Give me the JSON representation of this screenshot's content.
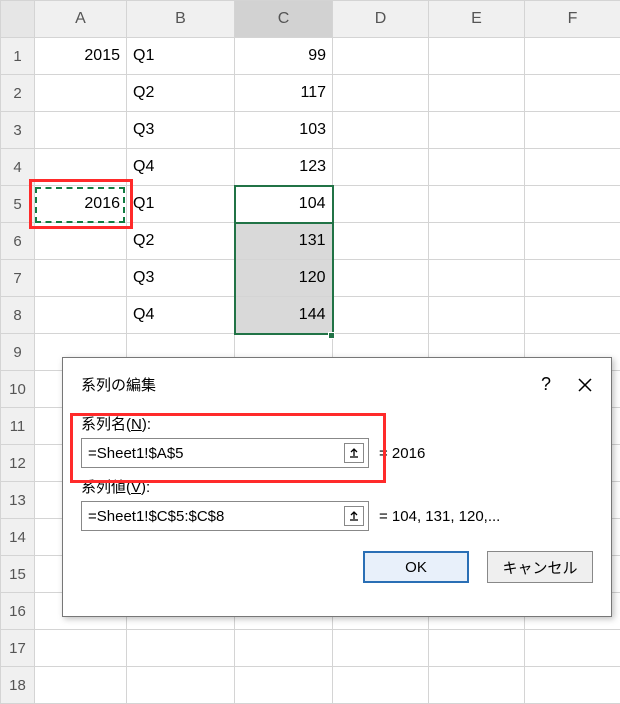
{
  "columns": [
    "A",
    "B",
    "C",
    "D",
    "E",
    "F"
  ],
  "rowcount": 18,
  "cells": {
    "A1": "2015",
    "B1": "Q1",
    "C1": "99",
    "B2": "Q2",
    "C2": "117",
    "B3": "Q3",
    "C3": "103",
    "B4": "Q4",
    "C4": "123",
    "A5": "2016",
    "B5": "Q1",
    "C5": "104",
    "B6": "Q2",
    "C6": "131",
    "B7": "Q3",
    "C7": "120",
    "B8": "Q4",
    "C8": "144"
  },
  "dialog": {
    "title": "系列の編集",
    "name_label_prefix": "系列名(",
    "name_label_key": "N",
    "name_label_suffix": "):",
    "name_value": "=Sheet1!$A$5",
    "name_result": "= 2016",
    "val_label_prefix": "系列値(",
    "val_label_key": "V",
    "val_label_suffix": "):",
    "val_value": "=Sheet1!$C$5:$C$8",
    "val_result": "= 104, 131, 120,...",
    "ok": "OK",
    "cancel": "キャンセル",
    "help": "?"
  },
  "chart_data": {
    "type": "table",
    "note": "Spreadsheet data driving an Edit Series dialog",
    "series_name_ref": "=Sheet1!$A$5",
    "series_name_value": 2016,
    "series_values_ref": "=Sheet1!$C$5:$C$8",
    "series_values": [
      104,
      131,
      120,
      144
    ],
    "categories": [
      "Q1",
      "Q2",
      "Q3",
      "Q4"
    ],
    "years": {
      "2015": {
        "Q1": 99,
        "Q2": 117,
        "Q3": 103,
        "Q4": 123
      },
      "2016": {
        "Q1": 104,
        "Q2": 131,
        "Q3": 120,
        "Q4": 144
      }
    }
  }
}
